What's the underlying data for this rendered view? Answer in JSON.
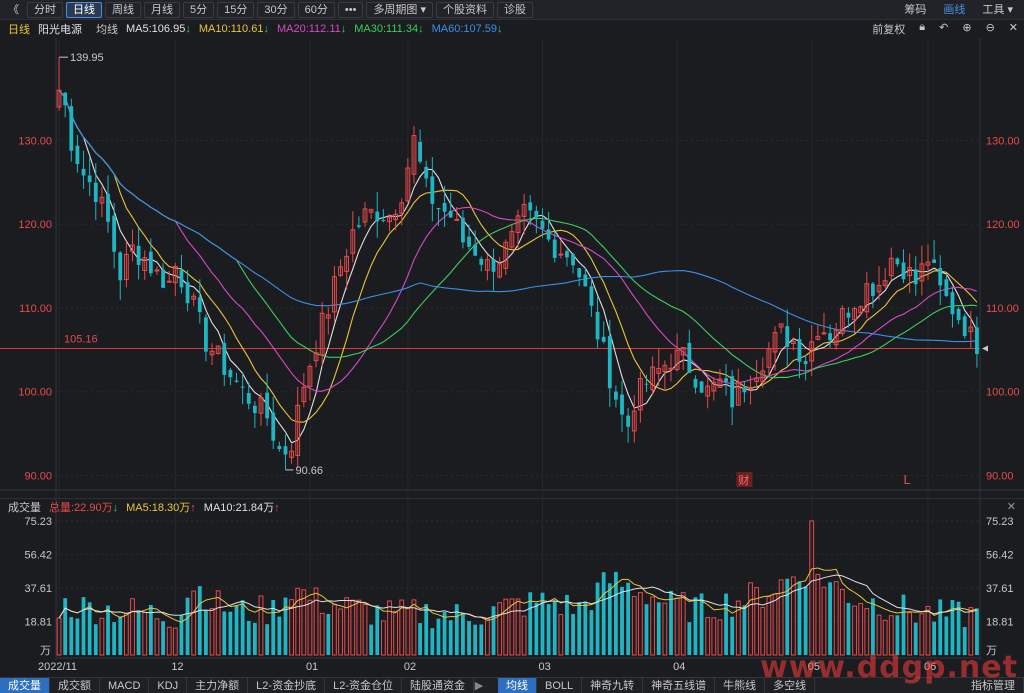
{
  "toolbar": {
    "back": "《",
    "buttons": [
      "分时",
      "日线",
      "周线",
      "月线",
      "5分",
      "15分",
      "30分",
      "60分",
      "•••",
      "多周期图",
      "个股资料",
      "诊股"
    ],
    "active": "日线",
    "right": [
      "筹码",
      "画线",
      "工具"
    ],
    "right_highlight": "画线"
  },
  "ma_legend": {
    "period": "日线",
    "stock": "阳光电源",
    "line_type": "均线",
    "items": [
      {
        "label": "MA5:106.95",
        "arrow": "↓",
        "color": "#e0e0e0"
      },
      {
        "label": "MA10:110.61",
        "arrow": "↓",
        "color": "#e8c53a"
      },
      {
        "label": "MA20:112.11",
        "arrow": "↓",
        "color": "#d849c8"
      },
      {
        "label": "MA30:111.34",
        "arrow": "↓",
        "color": "#3ccf5c"
      },
      {
        "label": "MA60:107.59",
        "arrow": "↓",
        "color": "#3a8fe8"
      }
    ],
    "adjust": "前复权",
    "arrow_color": "#2ecc71"
  },
  "price_axis": {
    "ticks": [
      "130.00",
      "120.00",
      "110.00",
      "100.00",
      "90.00"
    ],
    "values": [
      130,
      120,
      110,
      100,
      90
    ],
    "range": [
      88.5,
      142
    ],
    "current_price": 105.16,
    "current_label": "105.16",
    "high_label": "139.95",
    "low_label": "90.66",
    "high": 139.95,
    "low": 90.66
  },
  "markers": {
    "cai": "财",
    "l": "L"
  },
  "volume_legend": {
    "title": "成交量",
    "total": "总量:22.90万",
    "total_arrow": "↓",
    "ma5": "MA5:18.30万",
    "ma5_arrow": "↑",
    "ma10": "MA10:21.84万",
    "ma10_arrow": "↑",
    "close": "✕"
  },
  "volume_axis": {
    "ticks": [
      "75.23",
      "56.42",
      "37.61",
      "18.81"
    ],
    "values": [
      75.23,
      56.42,
      37.61,
      18.81
    ],
    "max": 78,
    "unit": "万"
  },
  "time_axis": {
    "labels": [
      "2022/11",
      "12",
      "01",
      "02",
      "03",
      "04",
      "05",
      "06"
    ],
    "indices": [
      0,
      19,
      41,
      57,
      79,
      101,
      123,
      142
    ]
  },
  "bottom_tabs": {
    "left": [
      "成交量",
      "成交额",
      "MACD",
      "KDJ",
      "主力净额",
      "L2-资金抄底",
      "L2-资金仓位",
      "陆股通资金"
    ],
    "left_active": "成交量",
    "more": "▶",
    "right": [
      "均线",
      "BOLL",
      "神奇九转",
      "神奇五线谱",
      "牛熊线",
      "多空线"
    ],
    "right_active": "均线",
    "extra": "指标管理"
  },
  "watermark": "www.ddgp.net",
  "chart_data": {
    "type": "candlestick",
    "series_count": 151,
    "anchors": [
      [
        0,
        138
      ],
      [
        2,
        130
      ],
      [
        4,
        126
      ],
      [
        6,
        124
      ],
      [
        8,
        120
      ],
      [
        10,
        114
      ],
      [
        12,
        117
      ],
      [
        14,
        116
      ],
      [
        16,
        114
      ],
      [
        18,
        113
      ],
      [
        19,
        115
      ],
      [
        21,
        112
      ],
      [
        22,
        110
      ],
      [
        24,
        106
      ],
      [
        26,
        104
      ],
      [
        28,
        102
      ],
      [
        30,
        100
      ],
      [
        32,
        98.5
      ],
      [
        34,
        97
      ],
      [
        36,
        93
      ],
      [
        37,
        91.5
      ],
      [
        38,
        94
      ],
      [
        40,
        101
      ],
      [
        42,
        106
      ],
      [
        44,
        110
      ],
      [
        46,
        115
      ],
      [
        48,
        119
      ],
      [
        50,
        121
      ],
      [
        52,
        121.5
      ],
      [
        54,
        121
      ],
      [
        56,
        124
      ],
      [
        57,
        127
      ],
      [
        58,
        130
      ],
      [
        59,
        127
      ],
      [
        60,
        124
      ],
      [
        62,
        122
      ],
      [
        64,
        121
      ],
      [
        66,
        118
      ],
      [
        68,
        117
      ],
      [
        70,
        115
      ],
      [
        72,
        116
      ],
      [
        74,
        118
      ],
      [
        76,
        121
      ],
      [
        78,
        120
      ],
      [
        80,
        118
      ],
      [
        82,
        117
      ],
      [
        84,
        116
      ],
      [
        86,
        112
      ],
      [
        88,
        107
      ],
      [
        90,
        102
      ],
      [
        92,
        97
      ],
      [
        93,
        96
      ],
      [
        94,
        99
      ],
      [
        96,
        101
      ],
      [
        98,
        102.5
      ],
      [
        100,
        104
      ],
      [
        102,
        104
      ],
      [
        104,
        102
      ],
      [
        106,
        100
      ],
      [
        108,
        101
      ],
      [
        110,
        99
      ],
      [
        112,
        101
      ],
      [
        114,
        103
      ],
      [
        116,
        105
      ],
      [
        118,
        107
      ],
      [
        120,
        106
      ],
      [
        122,
        104
      ],
      [
        124,
        108
      ],
      [
        126,
        107
      ],
      [
        128,
        109
      ],
      [
        130,
        111
      ],
      [
        132,
        112.5
      ],
      [
        134,
        113
      ],
      [
        136,
        116
      ],
      [
        138,
        115
      ],
      [
        140,
        113
      ],
      [
        142,
        116
      ],
      [
        144,
        112
      ],
      [
        146,
        110
      ],
      [
        148,
        108
      ],
      [
        150,
        105
      ]
    ],
    "volume_anchors": [
      [
        0,
        28
      ],
      [
        10,
        25
      ],
      [
        19,
        22
      ],
      [
        22,
        40
      ],
      [
        26,
        28
      ],
      [
        30,
        24
      ],
      [
        35,
        25
      ],
      [
        38,
        38
      ],
      [
        42,
        30
      ],
      [
        48,
        26
      ],
      [
        55,
        22
      ],
      [
        60,
        24
      ],
      [
        65,
        22
      ],
      [
        70,
        24
      ],
      [
        75,
        28
      ],
      [
        80,
        30
      ],
      [
        85,
        26
      ],
      [
        90,
        42
      ],
      [
        95,
        36
      ],
      [
        100,
        28
      ],
      [
        105,
        26
      ],
      [
        110,
        30
      ],
      [
        115,
        34
      ],
      [
        120,
        44
      ],
      [
        123,
        48
      ],
      [
        126,
        40
      ],
      [
        130,
        32
      ],
      [
        135,
        28
      ],
      [
        140,
        24
      ],
      [
        145,
        22
      ],
      [
        150,
        23
      ]
    ],
    "volume_spike": {
      "index": 123,
      "value": 75.23
    }
  }
}
